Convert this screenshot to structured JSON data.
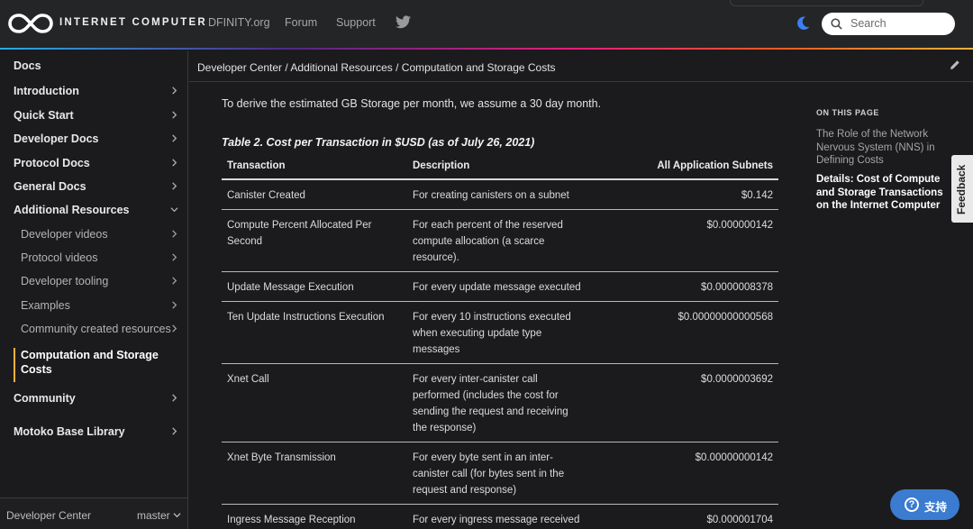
{
  "header": {
    "brand": "INTERNET COMPUTER",
    "nav": [
      "DFINITY.org",
      "Forum",
      "Support"
    ],
    "search_placeholder": "Search"
  },
  "sidebar": {
    "top": "Docs",
    "items": [
      "Introduction",
      "Quick Start",
      "Developer Docs",
      "Protocol Docs",
      "General Docs",
      "Additional Resources"
    ],
    "subitems": [
      "Developer videos",
      "Protocol videos",
      "Developer tooling",
      "Examples",
      "Community created resources"
    ],
    "active": "Computation and Storage Costs",
    "bottom_items": [
      "Community",
      "Motoko Base Library"
    ],
    "footer_left": "Developer Center",
    "footer_right": "master"
  },
  "breadcrumb": {
    "text": "Developer Center  /  Additional Resources  /  Computation and Storage Costs"
  },
  "content": {
    "intro": "To derive the estimated GB Storage per month, we assume a 30 day month.",
    "caption": "Table 2. Cost per Transaction in $USD (as of July 26, 2021)",
    "headers": [
      "Transaction",
      "Description",
      "All Application Subnets"
    ],
    "rows": [
      {
        "t": "Canister Created",
        "d": "For creating canisters on a subnet",
        "v": "$0.142"
      },
      {
        "t": "Compute Percent Allocated Per Second",
        "d": "For each percent of the reserved compute allocation (a scarce resource).",
        "v": "$0.000000142"
      },
      {
        "t": "Update Message Execution",
        "d": "For every update message executed",
        "v": "$0.0000008378"
      },
      {
        "t": "Ten Update Instructions Execution",
        "d": "For every 10 instructions executed when executing update type messages",
        "v": "$0.00000000000568"
      },
      {
        "t": "Xnet Call",
        "d": "For every inter-canister call performed (includes the cost for sending the request and receiving the response)",
        "v": "$0.0000003692"
      },
      {
        "t": "Xnet Byte Transmission",
        "d": "For every byte sent in an inter-canister call (for bytes sent in the request and response)",
        "v": "$0.00000000142"
      },
      {
        "t": "Ingress Message Reception",
        "d": "For every ingress message received",
        "v": "$0.000001704"
      }
    ]
  },
  "toc": {
    "heading": "ON THIS PAGE",
    "item1": "The Role of the Network Nervous System (NNS) in Defining Costs",
    "item2": "Details: Cost of Compute and Storage Transactions on the Internet Computer"
  },
  "feedback": "Feedback",
  "support": "支持"
}
